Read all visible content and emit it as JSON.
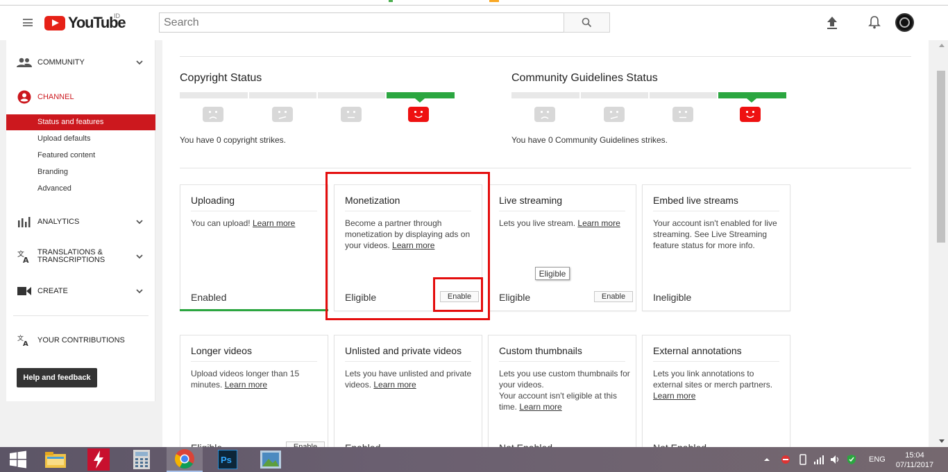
{
  "header": {
    "logo_text": "YouTube",
    "logo_sup": "ID",
    "search_placeholder": "Search"
  },
  "sidebar": {
    "community": "COMMUNITY",
    "channel": "CHANNEL",
    "sub_items": [
      "Status and features",
      "Upload defaults",
      "Featured content",
      "Branding",
      "Advanced"
    ],
    "analytics": "ANALYTICS",
    "translations": "TRANSLATIONS & TRANSCRIPTIONS",
    "create": "CREATE",
    "contributions": "YOUR CONTRIBUTIONS",
    "help": "Help and feedback"
  },
  "status": {
    "copyright_title": "Copyright Status",
    "copyright_text": "You have 0 copyright strikes.",
    "community_title": "Community Guidelines Status",
    "community_text": "You have 0 Community Guidelines strikes."
  },
  "cards": [
    {
      "title": "Uploading",
      "desc": "You can upload! ",
      "link": "Learn more",
      "state": "Enabled",
      "button": ""
    },
    {
      "title": "Monetization",
      "desc": "Become a partner through monetization by displaying ads on your videos. ",
      "link": "Learn more",
      "state": "Eligible",
      "button": "Enable"
    },
    {
      "title": "Live streaming",
      "desc": "Lets you live stream. ",
      "link": "Learn more",
      "state": "Eligible",
      "button": "Enable"
    },
    {
      "title": "Embed live streams",
      "desc": "Your account isn't enabled for live streaming. See Live Streaming feature status for more info.",
      "link": "",
      "state": "Ineligible",
      "button": ""
    },
    {
      "title": "Longer videos",
      "desc": "Upload videos longer than 15 minutes. ",
      "link": "Learn more",
      "state": "Eligible",
      "button": "Enable"
    },
    {
      "title": "Unlisted and private videos",
      "desc": "Lets you have unlisted and private videos. ",
      "link": "Learn more",
      "state": "Enabled",
      "button": ""
    },
    {
      "title": "Custom thumbnails",
      "desc": "Lets you use custom thumbnails for your videos.",
      "desc2": "Your account isn't eligible at this time. ",
      "link": "Learn more",
      "state": "Not Enabled",
      "button": ""
    },
    {
      "title": "External annotations",
      "desc": "Lets you link annotations to external sites or merch partners. ",
      "link": "Learn more",
      "state": "Not Enabled",
      "button": ""
    }
  ],
  "tooltip": "Eligible",
  "taskbar": {
    "lang": "ENG",
    "time": "15:04",
    "date": "07/11/2017"
  },
  "colors": {
    "brand_red": "#e62117",
    "active_nav": "#cc181e",
    "status_green": "#2ba640",
    "highlight_red": "#e40d0d"
  }
}
